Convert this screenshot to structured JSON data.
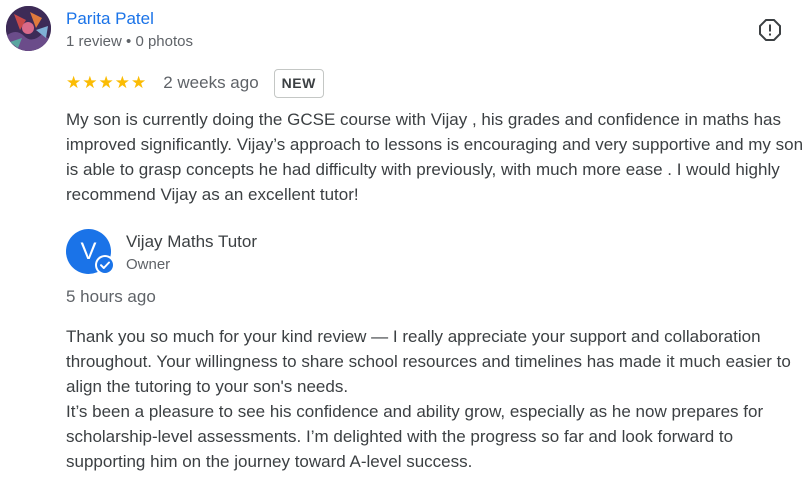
{
  "review": {
    "reviewer_name": "Parita Patel",
    "reviewer_meta": "1 review • 0 photos",
    "report_icon": "report-icon",
    "rating": 5,
    "stars": "★★★★★",
    "date": "2 weeks ago",
    "badge": "NEW",
    "text": "My son is currently doing the GCSE course with Vijay , his grades and confidence in maths has improved significantly. Vijay’s approach to lessons is encouraging and very supportive and my son is able to grasp concepts he had difficulty with previously, with much more ease . I would highly recommend Vijay as an excellent tutor!"
  },
  "reply": {
    "avatar_letter": "V",
    "owner_name": "Vijay Maths Tutor",
    "owner_role": "Owner",
    "date": "5 hours ago",
    "paragraph_1": "Thank you so much for your kind review — I really appreciate your support and collaboration throughout. Your willingness to share school resources and timelines has made it much easier to align the tutoring to your son's needs.",
    "paragraph_2": "It’s been a pleasure to see his confidence and ability grow, especially as he now prepares for scholarship-level assessments. I’m delighted with the progress so far and look forward to supporting him on the journey toward A-level success."
  },
  "colors": {
    "link_blue": "#1a73e8",
    "star_yellow": "#fbbc04",
    "secondary_text": "#5f6368",
    "owner_avatar": "#1a73e8"
  }
}
